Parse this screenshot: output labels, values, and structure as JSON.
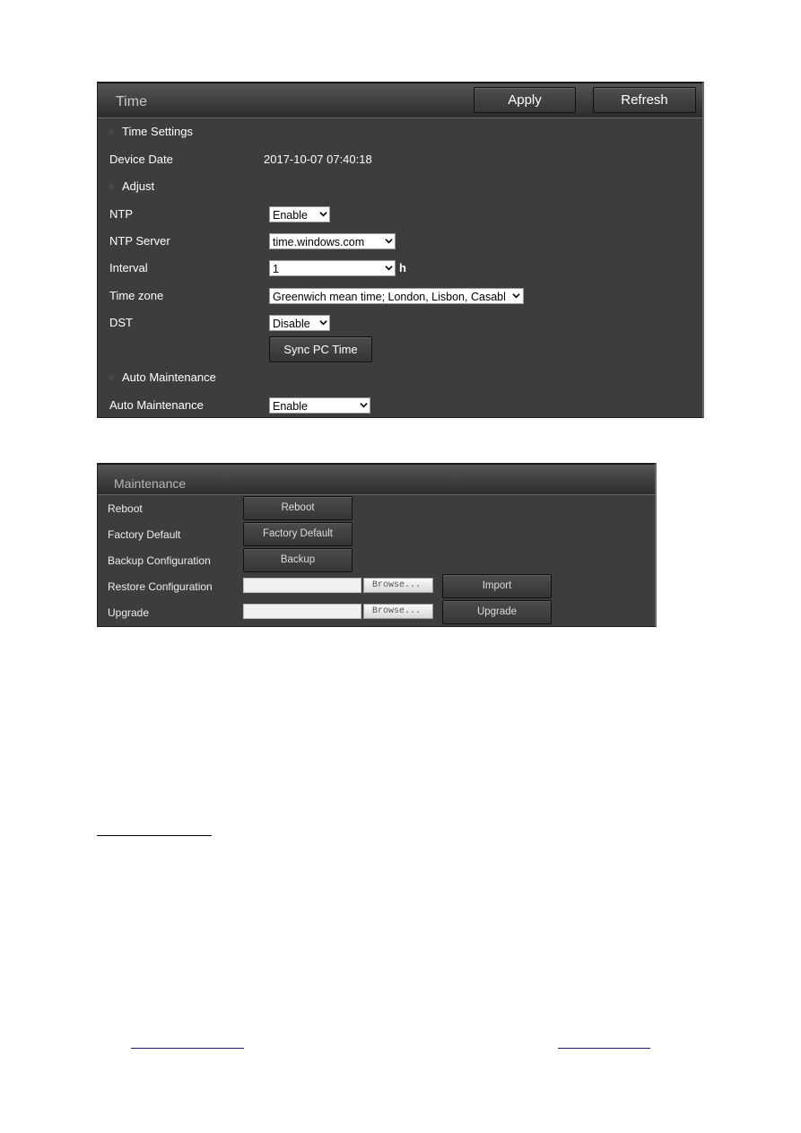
{
  "time_panel": {
    "title": "Time",
    "apply_label": "Apply",
    "refresh_label": "Refresh",
    "sections": {
      "time_settings": "Time Settings",
      "adjust": "Adjust",
      "auto_maintenance": "Auto Maintenance"
    },
    "device_date": {
      "label": "Device Date",
      "value": "2017-10-07 07:40:18"
    },
    "ntp": {
      "label": "NTP",
      "value": "Enable"
    },
    "ntp_server": {
      "label": "NTP Server",
      "value": "time.windows.com"
    },
    "interval": {
      "label": "Interval",
      "value": "1",
      "unit": "h"
    },
    "time_zone": {
      "label": "Time zone",
      "value": "Greenwich mean time; London, Lisbon, Casabl"
    },
    "dst": {
      "label": "DST",
      "value": "Disable"
    },
    "sync_pc_time_label": "Sync PC Time",
    "auto_maintenance": {
      "label": "Auto Maintenance",
      "value": "Enable"
    }
  },
  "maintenance_panel": {
    "title": "Maintenance",
    "rows": {
      "reboot": {
        "label": "Reboot",
        "button": "Reboot"
      },
      "factory_default": {
        "label": "Factory Default",
        "button": "Factory Default"
      },
      "backup": {
        "label": "Backup Configuration",
        "button": "Backup"
      },
      "restore": {
        "label": "Restore Configuration",
        "browse": "Browse...",
        "button": "Import"
      },
      "upgrade": {
        "label": "Upgrade",
        "browse": "Browse...",
        "button": "Upgrade"
      }
    }
  },
  "colors": {
    "panel_bg": "#3d3d3d",
    "header_text": "#c8c8c8",
    "link_underline": "#1a1a7a"
  }
}
